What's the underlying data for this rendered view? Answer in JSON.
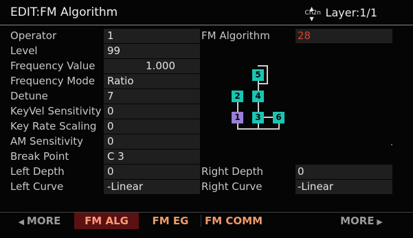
{
  "header": {
    "title": "EDIT:FM Algorithm",
    "layer_label": "Layer:1/1",
    "layer_icon_text": "Ch2n"
  },
  "params": [
    {
      "label": "Operator",
      "value": "1"
    },
    {
      "label": "Level",
      "value": "99"
    },
    {
      "label": "Frequency Value",
      "value": "1.000"
    },
    {
      "label": "Frequency Mode",
      "value": "Ratio"
    },
    {
      "label": "Detune",
      "value": "7"
    },
    {
      "label": "KeyVel Sensitivity",
      "value": "0"
    },
    {
      "label": "Key Rate Scaling",
      "value": "0"
    },
    {
      "label": "AM Sensitivity",
      "value": "0"
    },
    {
      "label": "Break Point",
      "value": "C 3"
    },
    {
      "label": "Left Depth",
      "value": "0"
    },
    {
      "label": "Left Curve",
      "value": "-Linear"
    }
  ],
  "right_params": {
    "algorithm_label": "FM Algorithm",
    "algorithm_value": "28",
    "right_depth_label": "Right Depth",
    "right_depth_value": "0",
    "right_curve_label": "Right Curve",
    "right_curve_value": "-Linear"
  },
  "diagram": {
    "operators": [
      "1",
      "2",
      "3",
      "4",
      "5",
      "6"
    ],
    "colors": {
      "carrier": "#9a7fd6",
      "modulator": "#17c7b3"
    }
  },
  "softkeys": {
    "more_left": "MORE",
    "fm_alg": "FM ALG",
    "fm_eg": "FM EG",
    "fm_comm": "FM COMM",
    "more_right": "MORE"
  },
  "colors": {
    "accent": "#d8452c",
    "active_tab_bg": "#5a1111",
    "tab_text": "#f09a6a"
  }
}
